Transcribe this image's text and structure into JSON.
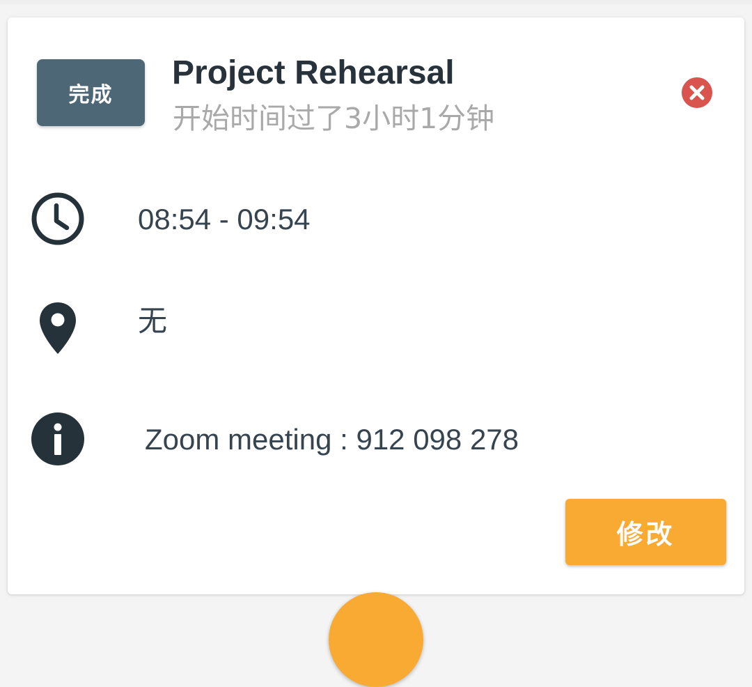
{
  "card": {
    "status_button_label": "完成",
    "title": "Project Rehearsal",
    "subtitle": "开始时间过了3小时1分钟",
    "time_range": "08:54 - 09:54",
    "location": "无",
    "info": "Zoom meeting : 912 098 278",
    "edit_button_label": "修改"
  },
  "icons": {
    "delete": "close-circle-icon",
    "time": "clock-icon",
    "location": "map-pin-icon",
    "info": "info-icon"
  },
  "colors": {
    "status_button": "#4e6776",
    "delete": "#d9534f",
    "edit_button": "#f9aa33",
    "fab": "#f9aa33",
    "icon": "#25323a"
  }
}
